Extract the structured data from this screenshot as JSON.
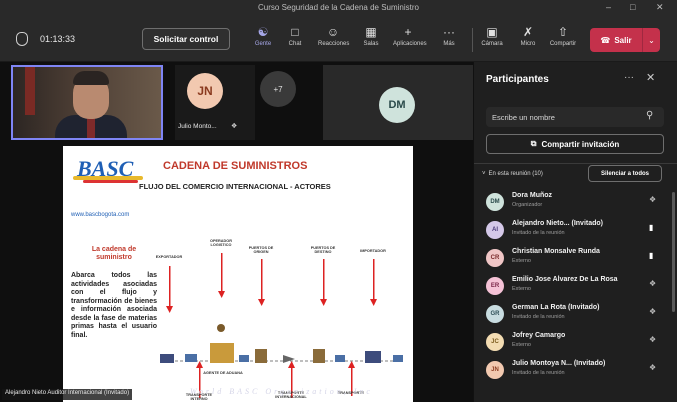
{
  "window": {
    "title": "Curso Seguridad de la Cadena de Suministro",
    "minimize": "–",
    "maximize": "□",
    "close": "✕"
  },
  "toolbar": {
    "timer": "01:13:33",
    "request_control": "Solicitar control",
    "items": [
      {
        "label": "Gente",
        "icon": "people-icon"
      },
      {
        "label": "Chat",
        "icon": "chat-icon"
      },
      {
        "label": "Reacciones",
        "icon": "reactions-icon"
      },
      {
        "label": "Salas",
        "icon": "rooms-icon"
      },
      {
        "label": "Aplicaciones",
        "icon": "apps-icon"
      },
      {
        "label": "Más",
        "icon": "more-icon"
      },
      {
        "label": "Cámara",
        "icon": "camera-icon"
      },
      {
        "label": "Micro",
        "icon": "mic-off-icon"
      },
      {
        "label": "Compartir",
        "icon": "share-icon"
      }
    ],
    "leave": "Salir"
  },
  "stage": {
    "jn_initials": "JN",
    "jn_name": "Julio Monto...",
    "overflow": "+7",
    "dm_initials": "DM",
    "presenter_tag": "Alejandro Nieto Auditor Internacional (Invitado)"
  },
  "slide": {
    "logo": "BASC",
    "title": "CADENA DE SUMINISTROS",
    "subtitle": "FLUJO DEL COMERCIO INTERNACIONAL - ACTORES",
    "website": "www.bascbogota.com",
    "chain_heading": "La cadena de suministro",
    "body": "Abarca todos las actividades asociadas con el flujo y transformación de bienes e información asociada desde la fase de materias primas hasta el usuario final.",
    "labels": {
      "exportador": "EXPORTADOR",
      "operador": "OPERADOR LOGISTICO",
      "puertos_origen": "PUERTOS DE ORIGEN",
      "puertos_destino": "PUERTOS DE DESTINO",
      "importador": "IMPORTADOR",
      "transporte_interno": "TRANSPORTE INTERNO",
      "agente": "AGENTE DE ADUANA",
      "transporte_int": "TRANSPORTE INTERNACIONAL",
      "transporte": "TRANSPORTE"
    },
    "footer": "World BASC Organization, Inc"
  },
  "panel": {
    "title": "Participantes",
    "search_placeholder": "Escribe un nombre",
    "share_invite": "Compartir invitación",
    "in_meeting": "En esta reunión (10)",
    "mute_all": "Silenciar a todos",
    "participants": [
      {
        "initials": "DM",
        "name": "Dora Muñoz",
        "role": "Organizador",
        "color": "#cfe3dc",
        "fg": "#2a4a4a"
      },
      {
        "initials": "AI",
        "name": "Alejandro Nieto... (Invitado)",
        "role": "Invitado de la reunión",
        "color": "#d4c8e8",
        "fg": "#4b3b7a"
      },
      {
        "initials": "CR",
        "name": "Christian Monsalve Runda",
        "role": "Externo",
        "color": "#f0c6c6",
        "fg": "#7a2b2b"
      },
      {
        "initials": "ER",
        "name": "Emilio Jose Alvarez De La Rosa",
        "role": "Externo",
        "color": "#f5c2d6",
        "fg": "#7a2548"
      },
      {
        "initials": "GR",
        "name": "German La Rota (Invitado)",
        "role": "Invitado de la reunión",
        "color": "#c8dce0",
        "fg": "#2e4f57"
      },
      {
        "initials": "JC",
        "name": "Jofrey Camargo",
        "role": "Externo",
        "color": "#f3dcb2",
        "fg": "#7a5a1c"
      },
      {
        "initials": "JN",
        "name": "Julio Montoya N... (Invitado)",
        "role": "Invitado de la reunión",
        "color": "#f2c9b0",
        "fg": "#8a3a1f"
      }
    ]
  }
}
